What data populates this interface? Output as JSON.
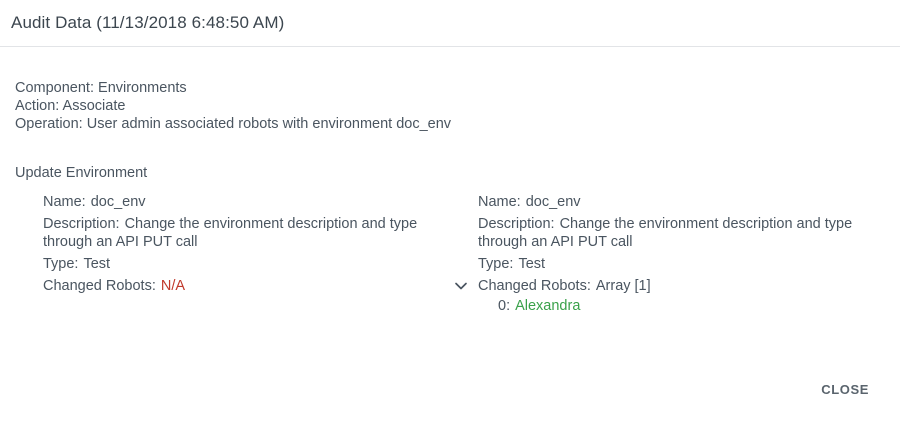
{
  "dialog": {
    "title": "Audit Data (11/13/2018 6:48:50 AM)",
    "close_label": "CLOSE"
  },
  "meta": {
    "component": "Component: Environments",
    "action": "Action: Associate",
    "operation": "Operation: User admin associated robots with environment doc_env"
  },
  "section_title": "Update Environment",
  "old": {
    "name_label": "Name:",
    "name_value": "doc_env",
    "description_label": "Description:",
    "description_value": "Change the environment description and type through an API PUT call",
    "type_label": "Type:",
    "type_value": "Test",
    "robots_label": "Changed Robots:",
    "robots_value": "N/A"
  },
  "new": {
    "name_label": "Name:",
    "name_value": "doc_env",
    "description_label": "Description:",
    "description_value": "Change the environment description and type through an API PUT call",
    "type_label": "Type:",
    "type_value": "Test",
    "robots_label": "Changed Robots:",
    "robots_value": "Array [1]",
    "robots_items": [
      {
        "index": "0:",
        "value": "Alexandra"
      }
    ]
  },
  "icons": {
    "expand": "chevron-down-icon"
  },
  "colors": {
    "removed": "#c0392b",
    "added": "#3aa14a"
  }
}
